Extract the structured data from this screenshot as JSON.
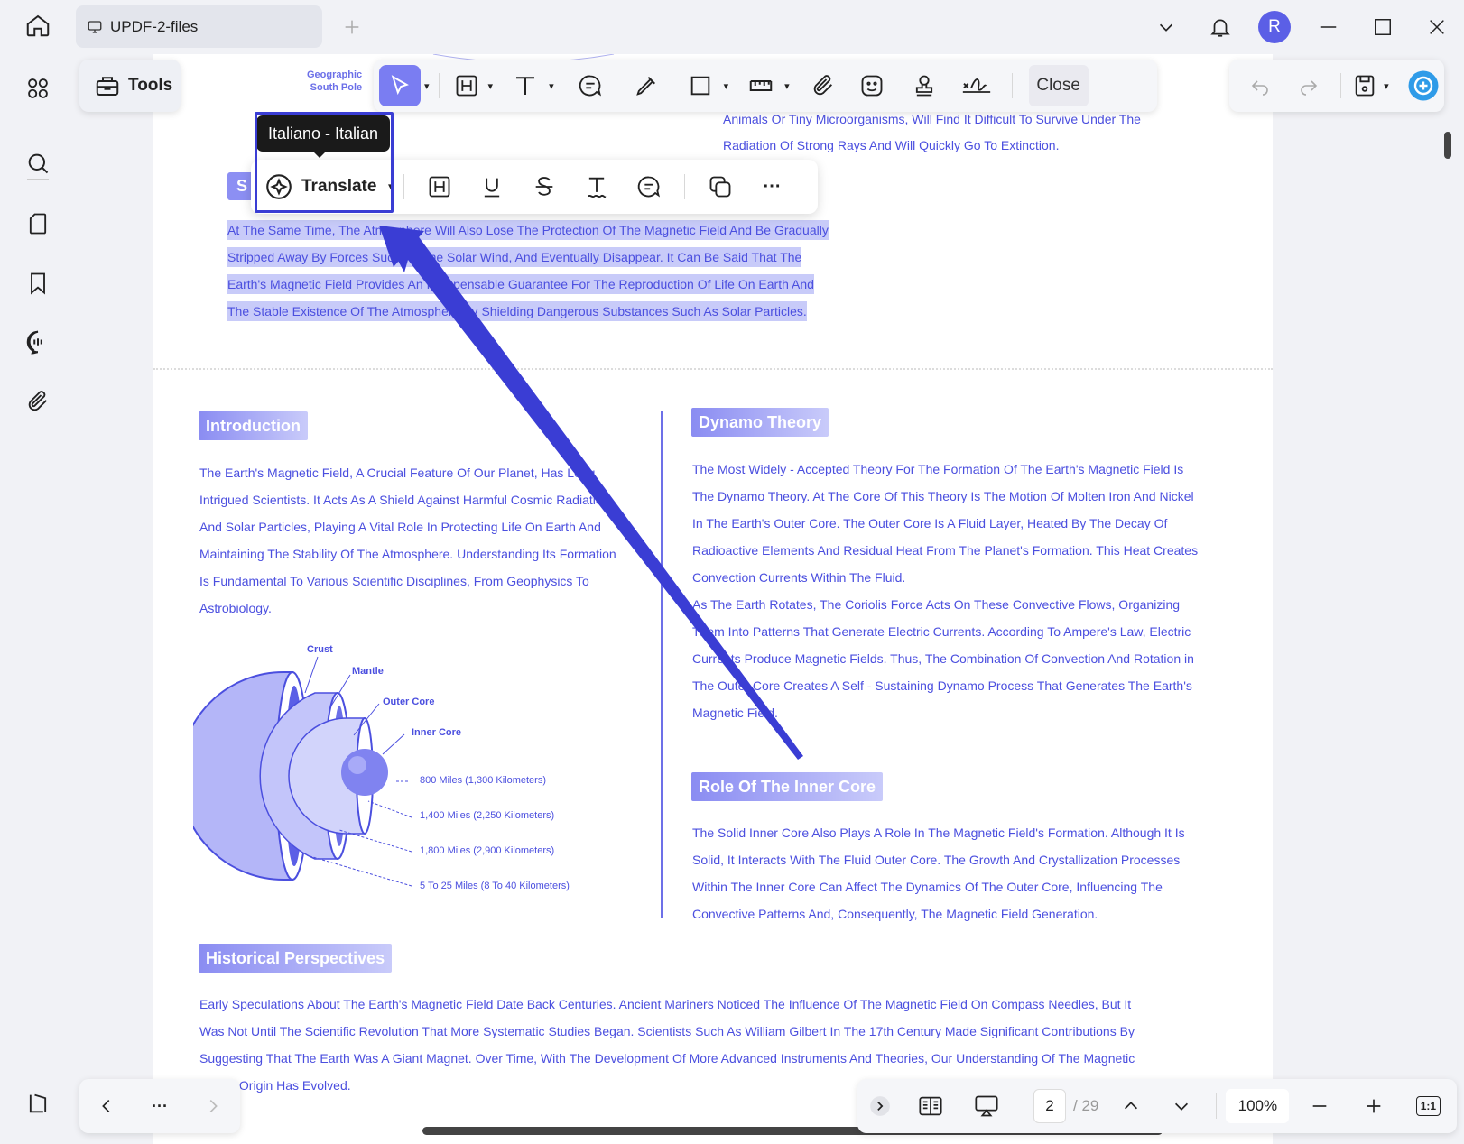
{
  "tab": {
    "title": "UPDF-2-files",
    "icon": "monitor-icon"
  },
  "window": {
    "avatar_initial": "R",
    "icons": [
      "chevron-down-icon",
      "bell-icon",
      "minimize-icon",
      "maximize-icon",
      "close-icon"
    ]
  },
  "leftbar": {
    "icons": [
      "home-icon",
      "grid-icon",
      "search-icon",
      "page-icon",
      "bookmark-icon",
      "chat-ai-icon",
      "attachment-icon",
      "layers-icon"
    ]
  },
  "toolbar": {
    "tools_label": "Tools",
    "close_label": "Close"
  },
  "selection_toolbar": {
    "translate_label": "Translate",
    "tooltip": "Italiano - Italian",
    "more": "···"
  },
  "document": {
    "geo_label": [
      "Geographic",
      "South Pole"
    ],
    "top_right_lines": [
      "Animals Or Tiny Microorganisms, Will Find It Difficult To Survive Under The",
      "Radiation Of Strong Rays And Will Quickly Go To Extinction."
    ],
    "section_s_letter": "S",
    "selected_lines": [
      "At The Same Time, The Atmosphere Will Also Lose The Protection Of The Magnetic Field And Be Gradually",
      "Stripped Away By Forces Such As The Solar Wind, And Eventually Disappear. It Can Be Said That The",
      "Earth's Magnetic Field Provides An Indispensable Guarantee For The Reproduction Of Life On Earth And",
      "The Stable Existence Of The Atmosphere By Shielding Dangerous Substances Such As Solar Particles."
    ],
    "introduction": {
      "heading": "Introduction",
      "lines": [
        "The Earth's Magnetic Field, A Crucial Feature Of Our Planet, Has Long",
        "Intrigued Scientists. It Acts As A Shield Against Harmful Cosmic Radiation",
        "And Solar Particles, Playing A Vital Role In Protecting Life On Earth And",
        "Maintaining The Stability Of The Atmosphere. Understanding Its Formation",
        "Is Fundamental To Various Scientific Disciplines, From Geophysics To",
        "Astrobiology."
      ]
    },
    "diagram": {
      "labels": [
        "Crust",
        "Mantle",
        "Outer Core",
        "Inner Core"
      ],
      "values": [
        "800 Miles (1,300 Kilometers)",
        "1,400 Miles (2,250 Kilometers)",
        "1,800 Miles (2,900 Kilometers)",
        "5 To 25 Miles (8 To 40 Kilometers)"
      ]
    },
    "dynamo": {
      "heading": "Dynamo Theory",
      "lines": [
        "The Most Widely - Accepted Theory For The Formation Of The Earth's Magnetic Field Is",
        "The Dynamo Theory. At The Core Of This Theory Is The Motion Of Molten Iron And Nickel",
        "In The Earth's Outer Core. The Outer Core Is A Fluid Layer, Heated By The Decay Of",
        "Radioactive Elements And Residual Heat From The Planet's Formation. This Heat Creates",
        "Convection Currents Within The Fluid.",
        "As The Earth Rotates, The Coriolis Force Acts On These Convective Flows, Organizing",
        "Them Into Patterns That Generate Electric Currents. According To Ampere's Law, Electric",
        "Currents Produce Magnetic Fields. Thus, The Combination Of Convection And Rotation in",
        "The Outer Core Creates A Self - Sustaining Dynamo Process That Generates The Earth's",
        "Magnetic Field."
      ]
    },
    "inner_core": {
      "heading": "Role Of The Inner Core",
      "lines": [
        "The Solid Inner Core Also Plays A Role In The Magnetic Field's Formation. Although It Is",
        "Solid, It Interacts With The Fluid Outer Core. The Growth And Crystallization Processes",
        "Within The Inner Core Can Affect The Dynamics Of The Outer Core, Influencing The",
        "Convective Patterns And, Consequently, The Magnetic Field Generation."
      ]
    },
    "historical": {
      "heading": "Historical Perspectives",
      "lines": [
        "Early Speculations About The Earth's Magnetic Field Date Back Centuries. Ancient Mariners Noticed The Influence Of The Magnetic Field On Compass Needles, But It",
        "Was Not Until The Scientific Revolution That More Systematic Studies Began. Scientists Such As William Gilbert In The 17th Century Made Significant Contributions By",
        "Suggesting That The Earth Was A Giant Magnet. Over Time, With The Development Of More Advanced Instruments And Theories, Our Understanding Of The Magnetic",
        "Field's Origin Has Evolved."
      ]
    }
  },
  "bottom": {
    "nav_more": "···",
    "page_current": "2",
    "page_total": "/ 29",
    "zoom": "100%",
    "fit_label": "1:1"
  },
  "colors": {
    "accent": "#5b5fe6",
    "doc_text": "#4b4fdf",
    "highlight": "#3a3dd4"
  }
}
